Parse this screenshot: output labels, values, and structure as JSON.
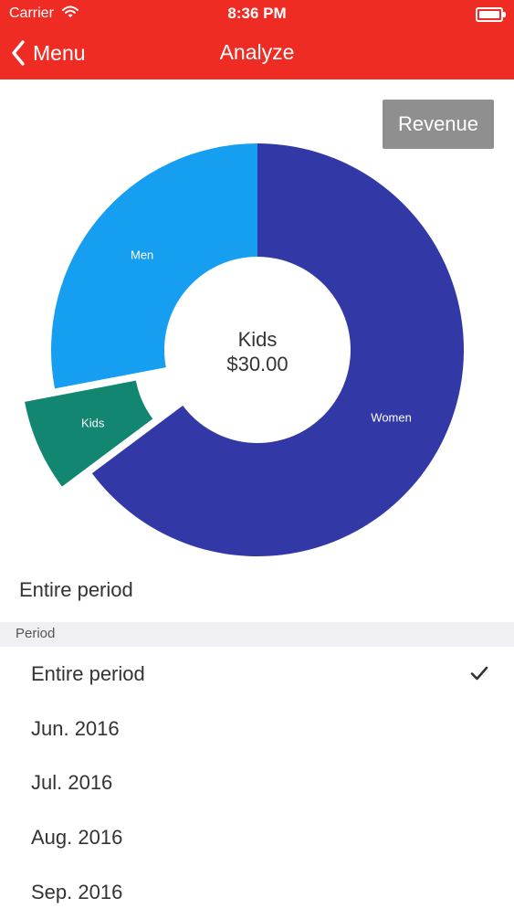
{
  "status_bar": {
    "carrier": "Carrier",
    "time": "8:36 PM"
  },
  "nav": {
    "back_label": "Menu",
    "title": "Analyze"
  },
  "metric_button": "Revenue",
  "chart_data": {
    "type": "pie",
    "slices": [
      {
        "label": "Women",
        "value": 64.8,
        "color": "#3238a6"
      },
      {
        "label": "Kids",
        "value": 7.2,
        "color": "#138672",
        "exploded": true
      },
      {
        "label": "Men",
        "value": 28.0,
        "color": "#169ef0"
      }
    ],
    "center_label": "Kids",
    "center_value": "$30.00"
  },
  "current_period": "Entire period",
  "period_section": {
    "header": "Period",
    "items": [
      {
        "label": "Entire period",
        "selected": true
      },
      {
        "label": "Jun. 2016",
        "selected": false
      },
      {
        "label": "Jul. 2016",
        "selected": false
      },
      {
        "label": "Aug. 2016",
        "selected": false
      },
      {
        "label": "Sep. 2016",
        "selected": false
      }
    ]
  }
}
